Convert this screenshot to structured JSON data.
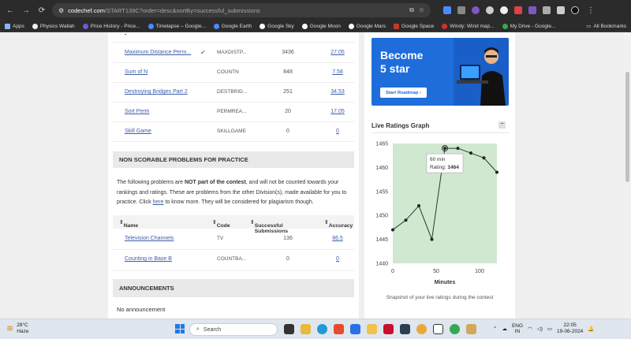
{
  "browser": {
    "url_host": "codechef.com",
    "url_path": "/START139C?order=desc&sortBy=successful_submissions"
  },
  "bookmarks": [
    {
      "label": "Apps",
      "color": "#8ab4f8"
    },
    {
      "label": "Physics Wallah",
      "color": "#222222"
    },
    {
      "label": "Price History - Price...",
      "color": "#6b5bd6"
    },
    {
      "label": "Timelapse – Google...",
      "color": "#4a8cff"
    },
    {
      "label": "Google Earth",
      "color": "#4a8cff"
    },
    {
      "label": "Google Sky",
      "color": "#ffffff"
    },
    {
      "label": "Google Moon",
      "color": "#ffffff"
    },
    {
      "label": "Google Mars",
      "color": "#ffffff"
    },
    {
      "label": "Google Space",
      "color": "#c0392b"
    },
    {
      "label": "Windy: Wind map...",
      "color": "#d32f2f"
    },
    {
      "label": "My Drive - Google...",
      "color": "#34a853"
    }
  ],
  "all_bookmarks": "All Bookmarks",
  "problems": [
    {
      "name": "Maximum Distance Perm...",
      "code": "MAXDISTP...",
      "submissions": "3436",
      "accuracy": "27.05",
      "solved": true
    },
    {
      "name": "Sum of N",
      "code": "COUNTN",
      "submissions": "848",
      "accuracy": "7.58",
      "solved": false
    },
    {
      "name": "Destroying Bridges Part 2",
      "code": "DESTBRID...",
      "submissions": "251",
      "accuracy": "34.53",
      "solved": false
    },
    {
      "name": "Sort Perm",
      "code": "PERMREA...",
      "submissions": "20",
      "accuracy": "17.05",
      "solved": false
    },
    {
      "name": "Skill Game",
      "code": "SKILLGAME",
      "submissions": "0",
      "accuracy": "0",
      "solved": false
    }
  ],
  "non_scorable": {
    "heading": "NON SCORABLE PROBLEMS FOR PRACTICE",
    "para_1": "The following problems are ",
    "para_bold": "NOT part of the contest",
    "para_2": ", and will not be counted towards your rankings and ratings. These are problems from the other Division(s), made available for you to practice. Click ",
    "para_link": "here",
    "para_3": " to know more. They will be considered for plagiarism though.",
    "columns": [
      "Name",
      "Code",
      "Successful Submissions",
      "Accuracy"
    ],
    "rows": [
      {
        "name": "Television Channels",
        "code": "TV",
        "submissions": "136",
        "accuracy": "86.5"
      },
      {
        "name": "Counting in Base B",
        "code": "COUNTBA...",
        "submissions": "0",
        "accuracy": "0"
      }
    ]
  },
  "announcements": {
    "heading": "ANNOUNCEMENTS",
    "text": "No announcement"
  },
  "sidebar": {
    "banner_title_1": "Become",
    "banner_title_2": "5 star",
    "banner_cta": "Start Roadmap",
    "ratings_heading": "Live Ratings Graph",
    "minimize": "−",
    "snapshot_caption": "Snapshot of your live ratings during the contest"
  },
  "chart_data": {
    "type": "line",
    "xlabel": "Minutes",
    "ylabel": "",
    "x_ticks": [
      "0",
      "50",
      "100"
    ],
    "y_ticks": [
      "1440",
      "1445",
      "1450",
      "1455",
      "1460",
      "1465"
    ],
    "xlim": [
      0,
      120
    ],
    "ylim": [
      1440,
      1465
    ],
    "series": [
      {
        "x": [
          0,
          15,
          30,
          45,
          60,
          75,
          90,
          105,
          120
        ],
        "y": [
          1447,
          1449,
          1452,
          1445,
          1464,
          1464,
          1463,
          1462,
          1459
        ]
      }
    ],
    "background_color": "#cfe8cf",
    "line_color": "#333333",
    "tooltip": {
      "time": "60 min",
      "label": "Rating:",
      "value": "1464"
    }
  },
  "taskbar": {
    "temp": "28°C",
    "condition": "Haze",
    "search": "Search",
    "lang_1": "ENG",
    "lang_2": "IN",
    "time": "22:05",
    "date": "19-06-2024"
  }
}
